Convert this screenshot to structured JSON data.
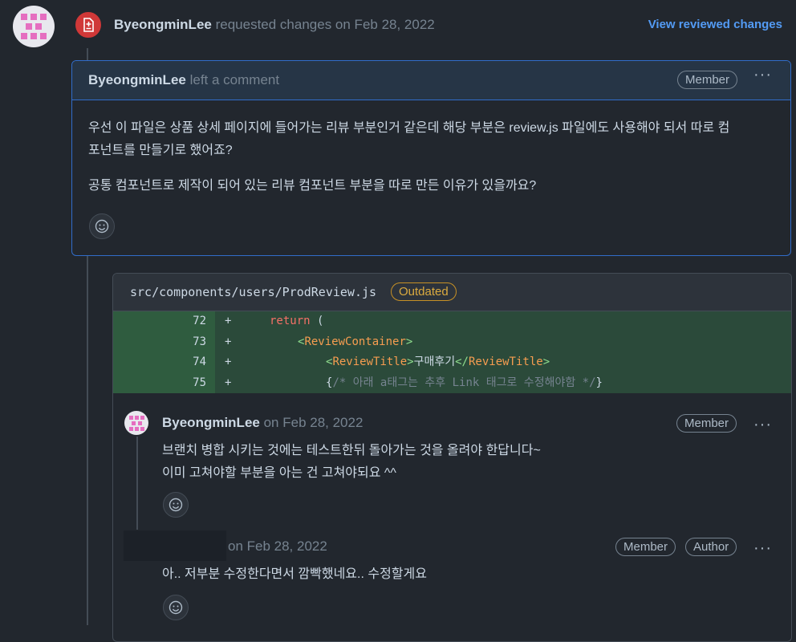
{
  "review": {
    "author": "ByeongminLee",
    "action": "requested changes on Feb 28, 2022",
    "view_link": "View reviewed changes"
  },
  "review_comment": {
    "author": "ByeongminLee",
    "action": "left a comment",
    "badge": "Member",
    "paragraph1_line1": "우선 이 파일은 상품 상세 페이지에 들어가는 리뷰 부분인거 같은데 해당 부분은 review.js 파일에도 사용해야 되서 따로 컴",
    "paragraph1_line2": "포넌트를 만들기로 했어죠?",
    "paragraph2": "공통 컴포넌트로 제작이 되어 있는 리뷰 컴포넌트 부분을 따로 만든 이유가 있을까요?"
  },
  "thread": {
    "file_path": "src/components/users/ProdReview.js",
    "status_badge": "Outdated",
    "diff": [
      {
        "line": "72",
        "sign": "+",
        "kw": "return",
        "rest": " ("
      },
      {
        "line": "73",
        "sign": "+",
        "open": "<",
        "name": "ReviewContainer",
        "close": ">"
      },
      {
        "line": "74",
        "sign": "+",
        "open": "<",
        "name": "ReviewTitle",
        "close": ">",
        "text": "구매후기",
        "end_open": "</",
        "end_name": "ReviewTitle",
        "end_close": ">"
      },
      {
        "line": "75",
        "sign": "+",
        "brace_open": "{",
        "comment": "/* 아래 a태그는 추후 Link 태그로 수정해야함 */",
        "brace_close": "}"
      }
    ],
    "comments": [
      {
        "author": "ByeongminLee",
        "date": "on Feb 28, 2022",
        "badge": "Member",
        "line1": "브랜치 병합 시키는 것에는 테스트한뒤 돌아가는 것을 올려야 한답니다~",
        "line2": "이미 고쳐야할 부분을 아는 건 고쳐야되요 ^^"
      },
      {
        "author": "",
        "date": "on Feb 28, 2022",
        "badge_member": "Member",
        "badge_author": "Author",
        "line1": "아.. 저부분 수정한다면서 깜빡했네요.. 수정할게요"
      }
    ]
  },
  "colors": {
    "background": "#22272e",
    "request_changes": "#d03838",
    "link": "#539bf5",
    "outdated": "#daaa3f",
    "diff_added": "#2b4a3a"
  }
}
